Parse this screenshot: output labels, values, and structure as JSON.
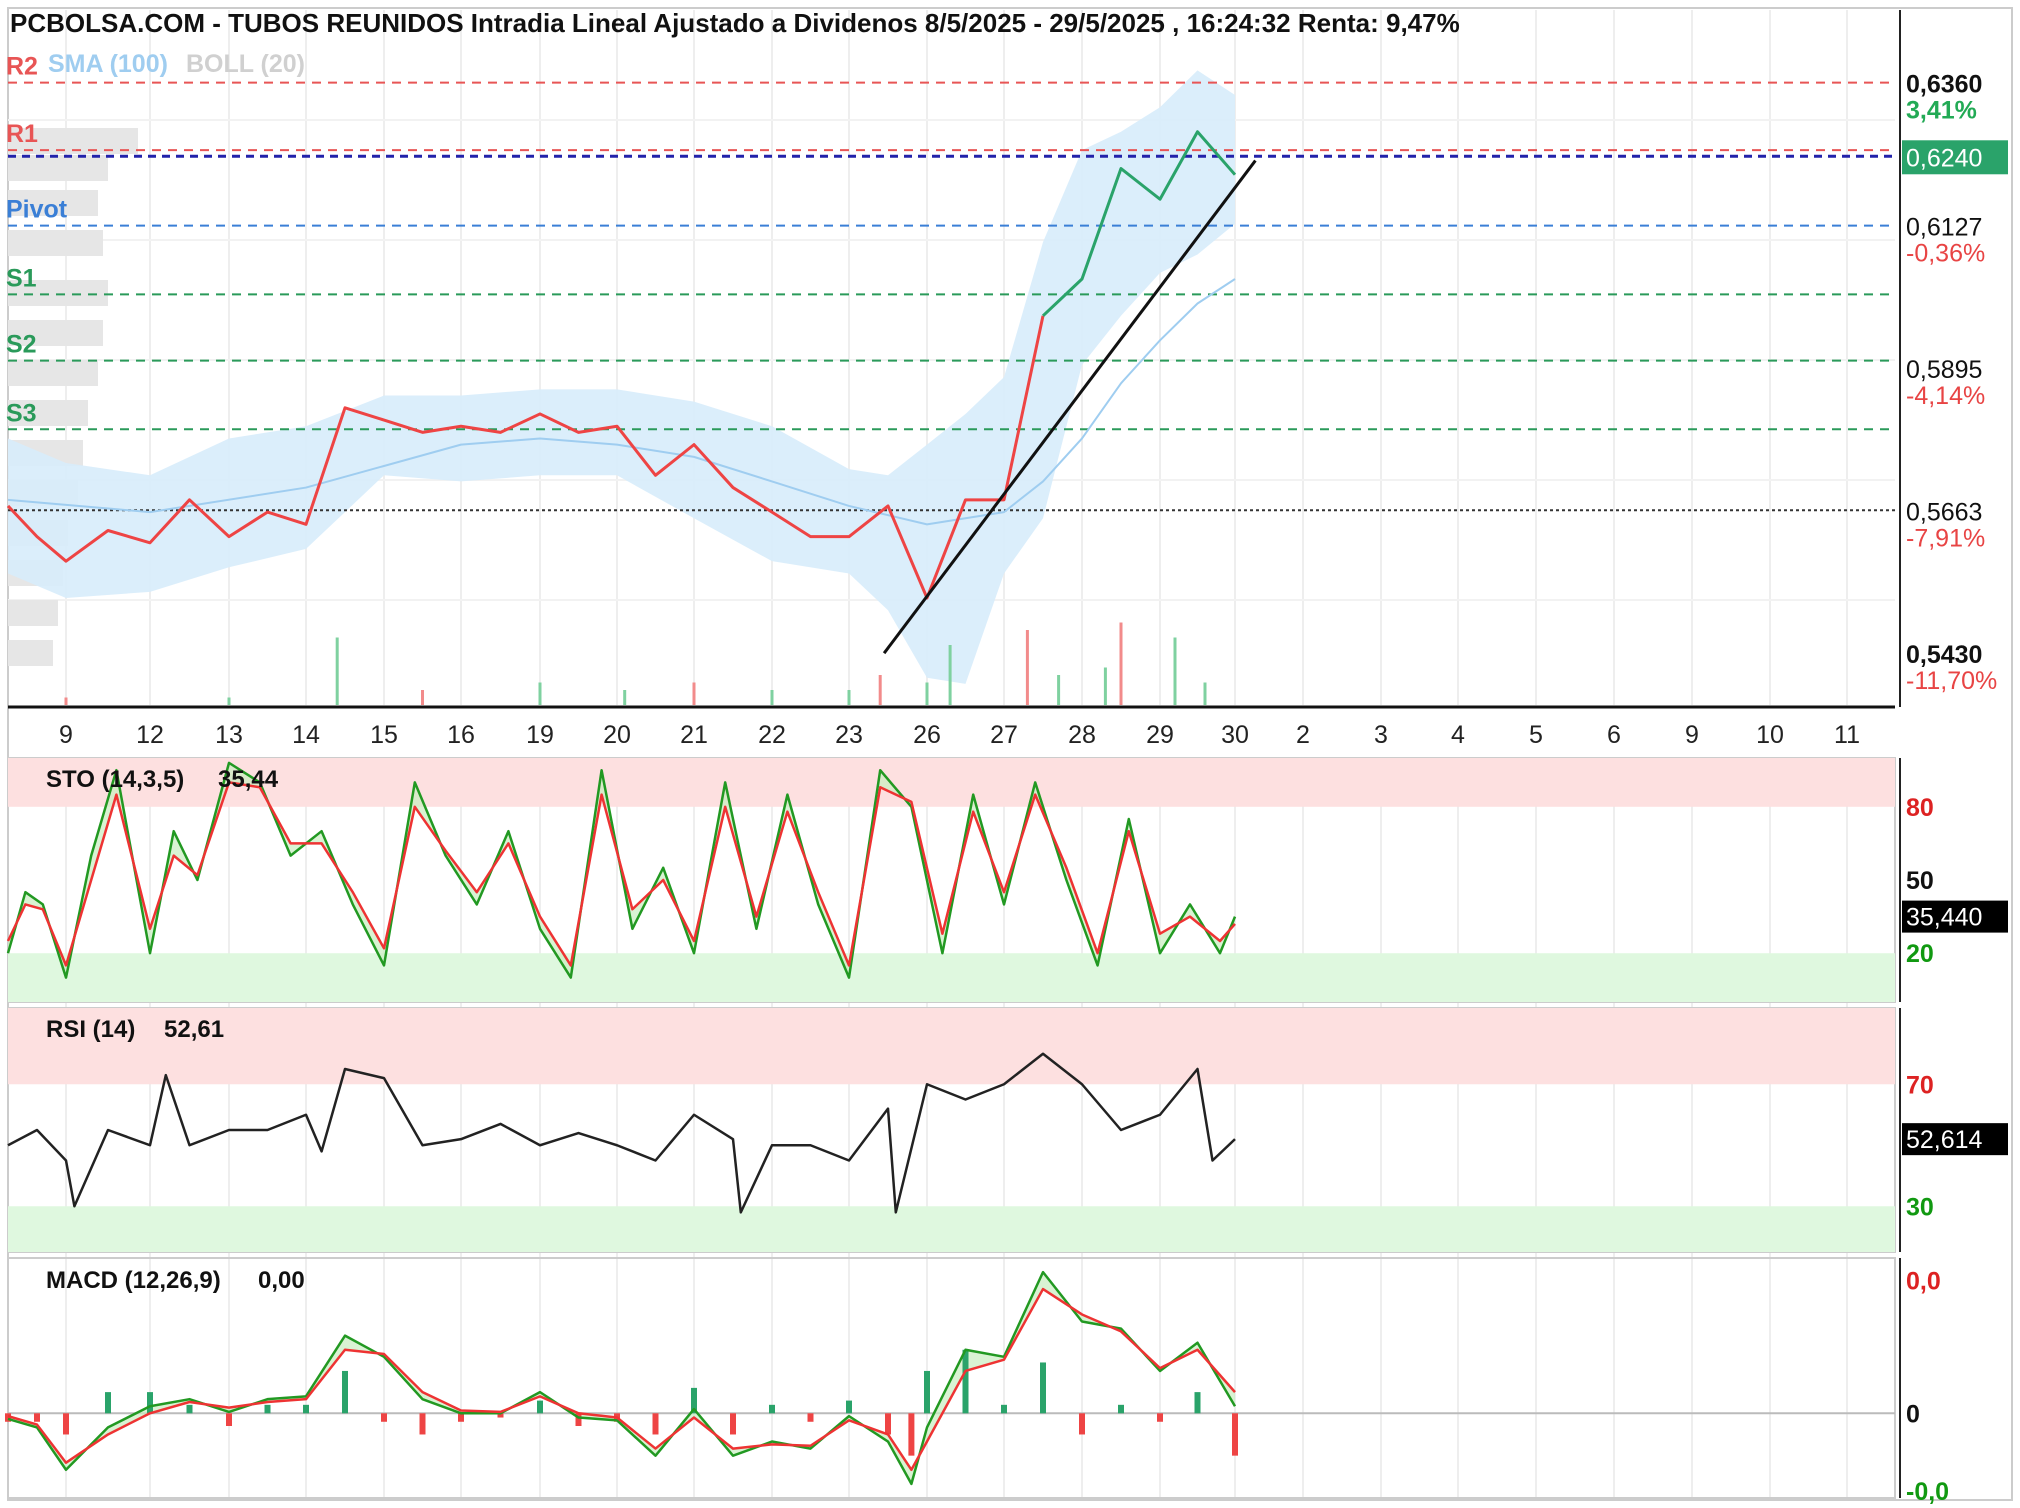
{
  "chart_data": [
    {
      "id": "price",
      "type": "line",
      "title": "PCBOLSA.COM - TUBOS REUNIDOS Intradia Lineal Ajustado a Dividenos 8/5/2025 - 29/5/2025 , 16:24:32 Renta: 9,47%",
      "indicators_legend": [
        "SMA (100)",
        "BOLL (20)"
      ],
      "x_ticks": [
        "9",
        "12",
        "13",
        "14",
        "15",
        "16",
        "19",
        "20",
        "21",
        "22",
        "23",
        "26",
        "27",
        "28",
        "29",
        "30",
        "2",
        "3",
        "4",
        "5",
        "6",
        "9",
        "10",
        "11"
      ],
      "ylim": [
        0.537,
        0.641
      ],
      "y_ticks": [
        {
          "value": 0.636,
          "label": "0,6360",
          "pct": "3,41%",
          "pct_color": "#22aa55"
        },
        {
          "value": 0.624,
          "label": "0,6240",
          "pct": "",
          "pct_color": "",
          "highlight": true
        },
        {
          "value": 0.6127,
          "label": "0,6127",
          "pct": "-0,36%",
          "pct_color": "#e84444"
        },
        {
          "value": 0.5895,
          "label": "0,5895",
          "pct": "-4,14%",
          "pct_color": "#e84444"
        },
        {
          "value": 0.5663,
          "label": "0,5663",
          "pct": "-7,91%",
          "pct_color": "#e84444"
        },
        {
          "value": 0.543,
          "label": "0,5430",
          "pct": "-11,70%",
          "pct_color": "#e84444"
        }
      ],
      "levels": [
        {
          "name": "R2",
          "value": 0.636,
          "color": "#e85555"
        },
        {
          "name": "R1",
          "value": 0.625,
          "color": "#e85555"
        },
        {
          "name": "Pivot",
          "value": 0.6127,
          "color": "#3a7fd6"
        },
        {
          "name": "S1",
          "value": 0.6015,
          "color": "#2a9a5a"
        },
        {
          "name": "S2",
          "value": 0.5907,
          "color": "#2a9a5a"
        },
        {
          "name": "S3",
          "value": 0.5795,
          "color": "#2a9a5a"
        }
      ],
      "current_price": 0.624,
      "reference_price": 0.5663,
      "series": [
        {
          "name": "Precio",
          "x": [
            0,
            0.5,
            1,
            1.5,
            2,
            2.5,
            3,
            3.5,
            4,
            4.5,
            5,
            5.5,
            6,
            6.5,
            7,
            7.5,
            8,
            8.5,
            9,
            9.5,
            10,
            10.5,
            11,
            11.5,
            12,
            12.5,
            13,
            13.5,
            14,
            14.5,
            15,
            15.5,
            16
          ],
          "values": [
            0.567,
            0.562,
            0.558,
            0.563,
            0.561,
            0.568,
            0.562,
            0.566,
            0.564,
            0.583,
            0.581,
            0.579,
            0.58,
            0.579,
            0.582,
            0.579,
            0.58,
            0.572,
            0.577,
            0.57,
            0.566,
            0.562,
            0.562,
            0.567,
            0.552,
            0.568,
            0.568,
            0.598,
            0.604,
            0.622,
            0.617,
            0.628,
            0.621
          ]
        },
        {
          "name": "SMA (100)",
          "x": [
            0,
            2,
            4,
            6,
            7,
            8,
            9,
            10,
            11,
            12,
            13,
            13.5,
            14,
            14.5,
            15,
            15.5,
            16
          ],
          "values": [
            0.568,
            0.566,
            0.57,
            0.577,
            0.578,
            0.577,
            0.575,
            0.571,
            0.567,
            0.564,
            0.566,
            0.571,
            0.578,
            0.587,
            0.594,
            0.6,
            0.604
          ]
        },
        {
          "name": "BOLL (20) upper",
          "x": [
            0,
            1,
            2,
            3,
            4,
            5,
            6,
            7,
            8,
            9,
            10,
            11,
            11.5,
            12,
            12.5,
            13,
            13.5,
            14,
            14.5,
            15,
            15.5,
            16
          ],
          "values": [
            0.578,
            0.574,
            0.572,
            0.578,
            0.58,
            0.585,
            0.585,
            0.586,
            0.586,
            0.584,
            0.58,
            0.573,
            0.572,
            0.577,
            0.582,
            0.588,
            0.61,
            0.625,
            0.628,
            0.632,
            0.638,
            0.634
          ]
        },
        {
          "name": "BOLL (20) lower",
          "x": [
            0,
            1,
            2,
            3,
            4,
            5,
            6,
            7,
            8,
            9,
            10,
            11,
            11.5,
            12,
            12.5,
            13,
            13.5,
            14,
            14.5,
            15,
            15.5,
            16
          ],
          "values": [
            0.556,
            0.552,
            0.553,
            0.557,
            0.56,
            0.572,
            0.571,
            0.572,
            0.572,
            0.565,
            0.558,
            0.556,
            0.55,
            0.539,
            0.538,
            0.556,
            0.565,
            0.59,
            0.598,
            0.605,
            0.608,
            0.613
          ]
        },
        {
          "name": "Tendencia",
          "x": [
            11.45,
            16.3
          ],
          "values": [
            0.543,
            0.6233
          ]
        },
        {
          "name": "Volumen",
          "x": [
            1,
            3,
            4.4,
            5.5,
            7,
            8.1,
            9,
            10,
            11,
            11.4,
            12,
            12.3,
            13.3,
            13.7,
            14.3,
            14.5,
            15.2,
            15.6
          ],
          "values": [
            0.1,
            0.1,
            0.9,
            0.2,
            0.3,
            0.2,
            0.3,
            0.2,
            0.2,
            0.4,
            0.3,
            0.8,
            1.0,
            0.4,
            0.5,
            1.1,
            0.9,
            0.3
          ]
        }
      ]
    },
    {
      "id": "sto",
      "type": "line",
      "label": "STO (14,3,5)",
      "value_text": "35,44",
      "current_label": "35,440",
      "ylim": [
        0,
        100
      ],
      "y_ticks": [
        {
          "value": 80,
          "label": "80",
          "color": "#dd2222"
        },
        {
          "value": 50,
          "label": "50",
          "color": "#111111"
        },
        {
          "value": 20,
          "label": "20",
          "color": "#119911"
        }
      ],
      "bands": [
        {
          "from": 80,
          "to": 100,
          "color": "#fde0e0"
        },
        {
          "from": 0,
          "to": 20,
          "color": "#dff8df"
        }
      ],
      "series": [
        {
          "name": "%K",
          "x": [
            0,
            0.3,
            0.6,
            1,
            1.3,
            1.6,
            2,
            2.3,
            2.6,
            3,
            3.4,
            3.8,
            4.2,
            4.6,
            5,
            5.4,
            5.8,
            6.2,
            6.6,
            7,
            7.4,
            7.8,
            8.2,
            8.6,
            9,
            9.4,
            9.8,
            10.2,
            10.6,
            11,
            11.4,
            11.8,
            12.2,
            12.6,
            13,
            13.4,
            13.8,
            14.2,
            14.6,
            15,
            15.4,
            15.8,
            16
          ],
          "values": [
            20,
            45,
            40,
            10,
            60,
            95,
            20,
            70,
            50,
            98,
            90,
            60,
            70,
            40,
            15,
            90,
            60,
            40,
            70,
            30,
            10,
            95,
            30,
            55,
            20,
            90,
            30,
            85,
            40,
            10,
            95,
            80,
            20,
            85,
            40,
            90,
            50,
            15,
            75,
            20,
            40,
            20,
            35
          ]
        },
        {
          "name": "%D",
          "x": [
            0,
            0.3,
            0.6,
            1,
            1.3,
            1.6,
            2,
            2.3,
            2.6,
            3,
            3.4,
            3.8,
            4.2,
            4.6,
            5,
            5.4,
            5.8,
            6.2,
            6.6,
            7,
            7.4,
            7.8,
            8.2,
            8.6,
            9,
            9.4,
            9.8,
            10.2,
            10.6,
            11,
            11.4,
            11.8,
            12.2,
            12.6,
            13,
            13.4,
            13.8,
            14.2,
            14.6,
            15,
            15.4,
            15.8,
            16
          ],
          "values": [
            25,
            40,
            38,
            15,
            50,
            85,
            30,
            60,
            52,
            90,
            88,
            65,
            65,
            45,
            22,
            80,
            62,
            45,
            65,
            35,
            15,
            85,
            38,
            50,
            25,
            80,
            35,
            78,
            45,
            15,
            88,
            82,
            28,
            78,
            45,
            85,
            55,
            20,
            70,
            28,
            35,
            25,
            32
          ]
        }
      ]
    },
    {
      "id": "rsi",
      "type": "line",
      "label": "RSI (14)",
      "value_text": "52,61",
      "current_label": "52,614",
      "ylim": [
        15,
        95
      ],
      "y_ticks": [
        {
          "value": 70,
          "label": "70",
          "color": "#dd2222"
        },
        {
          "value": 30,
          "label": "30",
          "color": "#119911"
        }
      ],
      "bands": [
        {
          "from": 70,
          "to": 95,
          "color": "#fde0e0"
        },
        {
          "from": 15,
          "to": 30,
          "color": "#dff8df"
        }
      ],
      "series": [
        {
          "name": "RSI",
          "x": [
            0,
            0.5,
            1,
            1.1,
            1.5,
            2,
            2.2,
            2.5,
            3,
            3.5,
            4,
            4.2,
            4.5,
            5,
            5.5,
            6,
            6.5,
            7,
            7.5,
            8,
            8.5,
            9,
            9.5,
            9.6,
            10,
            10.5,
            11,
            11.5,
            11.6,
            12,
            12.5,
            13,
            13.5,
            14,
            14.5,
            15,
            15.5,
            15.7,
            16
          ],
          "values": [
            50,
            55,
            45,
            30,
            55,
            50,
            73,
            50,
            55,
            55,
            60,
            48,
            75,
            72,
            50,
            52,
            57,
            50,
            54,
            50,
            45,
            60,
            52,
            28,
            50,
            50,
            45,
            62,
            28,
            70,
            65,
            70,
            80,
            70,
            55,
            60,
            75,
            45,
            52
          ]
        }
      ]
    },
    {
      "id": "macd",
      "type": "line",
      "label": "MACD (12,26,9)",
      "value_text": "0,00",
      "ylim": [
        -0.006,
        0.011
      ],
      "y_ticks": [
        {
          "value": 0.0094,
          "label": "0,0",
          "color": "#dd2222"
        },
        {
          "value": 0,
          "label": "0",
          "color": "#111111"
        },
        {
          "value": -0.0055,
          "label": "-0,0",
          "color": "#119911"
        }
      ],
      "series": [
        {
          "name": "MACD",
          "x": [
            0,
            0.5,
            1,
            1.5,
            2,
            2.5,
            3,
            3.5,
            4,
            4.5,
            5,
            5.5,
            6,
            6.5,
            7,
            7.5,
            8,
            8.5,
            9,
            9.5,
            10,
            10.5,
            11,
            11.5,
            11.8,
            12,
            12.5,
            13,
            13.5,
            14,
            14.5,
            15,
            15.5,
            16
          ],
          "values": [
            -0.0004,
            -0.001,
            -0.004,
            -0.001,
            0.0005,
            0.001,
            0.0001,
            0.001,
            0.0012,
            0.0055,
            0.004,
            0.001,
            0,
            0,
            0.0015,
            -0.0003,
            -0.0005,
            -0.003,
            0.0003,
            -0.003,
            -0.002,
            -0.0025,
            -0.0002,
            -0.002,
            -0.005,
            -0.001,
            0.0045,
            0.004,
            0.01,
            0.0065,
            0.006,
            0.003,
            0.005,
            0.0005
          ]
        },
        {
          "name": "Señal",
          "x": [
            0,
            0.5,
            1,
            1.5,
            2,
            2.5,
            3,
            3.5,
            4,
            4.5,
            5,
            5.5,
            6,
            6.5,
            7,
            7.5,
            8,
            8.5,
            9,
            9.5,
            10,
            10.5,
            11,
            11.5,
            11.8,
            12,
            12.5,
            13,
            13.5,
            14,
            14.5,
            15,
            15.5,
            16
          ],
          "values": [
            -0.0002,
            -0.0008,
            -0.0035,
            -0.0015,
            0,
            0.0008,
            0.0004,
            0.0008,
            0.001,
            0.0045,
            0.0042,
            0.0015,
            0.0002,
            0.0001,
            0.0012,
            0,
            -0.0003,
            -0.0025,
            -0.0003,
            -0.0025,
            -0.0022,
            -0.0023,
            -0.0005,
            -0.0015,
            -0.004,
            -0.002,
            0.003,
            0.0038,
            0.0088,
            0.007,
            0.0058,
            0.0032,
            0.0045,
            0.0015
          ]
        }
      ]
    }
  ]
}
